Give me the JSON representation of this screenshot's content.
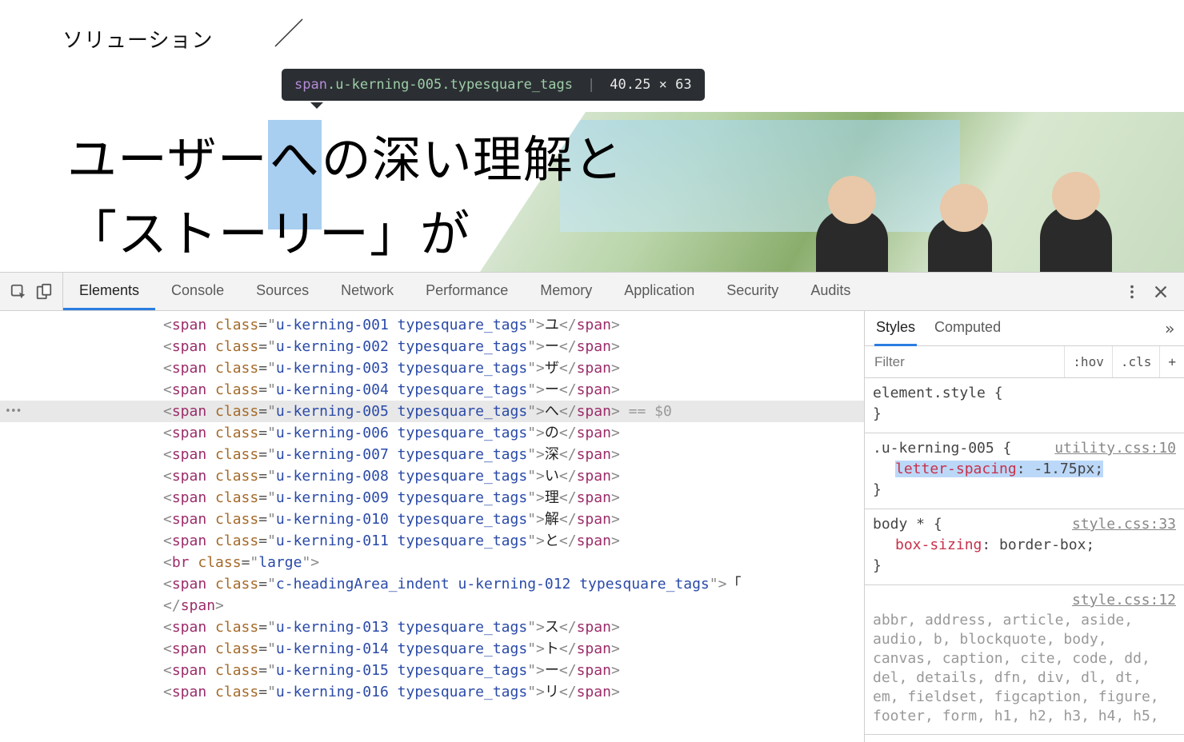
{
  "page": {
    "solution_label": "ソリューション",
    "headline_line1_before": "ユーザー",
    "headline_line1_highlight": "へ",
    "headline_line1_after": "の深い理解と",
    "headline_line2": "「ストーリー」が"
  },
  "tooltip": {
    "tag": "span",
    "classes": ".u-kerning-005.typesquare_tags",
    "separator": "|",
    "dimensions": "40.25 × 63"
  },
  "devtools": {
    "tabs": [
      "Elements",
      "Console",
      "Sources",
      "Network",
      "Performance",
      "Memory",
      "Application",
      "Security",
      "Audits"
    ],
    "active_tab": "Elements"
  },
  "elements": {
    "lines": [
      {
        "cls": "u-kerning-001 typesquare_tags",
        "txt": "ユ"
      },
      {
        "cls": "u-kerning-002 typesquare_tags",
        "txt": "ー"
      },
      {
        "cls": "u-kerning-003 typesquare_tags",
        "txt": "ザ"
      },
      {
        "cls": "u-kerning-004 typesquare_tags",
        "txt": "ー"
      },
      {
        "cls": "u-kerning-005 typesquare_tags",
        "txt": "へ",
        "selected": true,
        "suffix": "== $0"
      },
      {
        "cls": "u-kerning-006 typesquare_tags",
        "txt": "の"
      },
      {
        "cls": "u-kerning-007 typesquare_tags",
        "txt": "深"
      },
      {
        "cls": "u-kerning-008 typesquare_tags",
        "txt": "い"
      },
      {
        "cls": "u-kerning-009 typesquare_tags",
        "txt": "理"
      },
      {
        "cls": "u-kerning-010 typesquare_tags",
        "txt": "解"
      },
      {
        "cls": "u-kerning-011 typesquare_tags",
        "txt": "と"
      }
    ],
    "br_class": "large",
    "indent_span_class": "c-headingArea_indent u-kerning-012 typesquare_tags",
    "indent_span_text": "「",
    "lines2": [
      {
        "cls": "u-kerning-013 typesquare_tags",
        "txt": "ス"
      },
      {
        "cls": "u-kerning-014 typesquare_tags",
        "txt": "ト"
      },
      {
        "cls": "u-kerning-015 typesquare_tags",
        "txt": "ー"
      },
      {
        "cls": "u-kerning-016 typesquare_tags",
        "txt": "リ"
      }
    ]
  },
  "styles": {
    "subtabs": [
      "Styles",
      "Computed"
    ],
    "more_glyph": "»",
    "filter_placeholder": "Filter",
    "tool_hov": ":hov",
    "tool_cls": ".cls",
    "tool_plus": "+",
    "rules": [
      {
        "selector": "element.style {",
        "src": "",
        "props": [],
        "close": "}"
      },
      {
        "selector": ".u-kerning-005 {",
        "src": "utility.css:10",
        "props": [
          {
            "name": "letter-spacing",
            "value": "-1.75px;",
            "hl": true
          }
        ],
        "close": "}"
      },
      {
        "selector": "body * {",
        "src": "style.css:33",
        "props": [
          {
            "name": "box-sizing",
            "value": "border-box;"
          }
        ],
        "close": "}"
      }
    ],
    "reset_selector_src": "style.css:12",
    "reset_selectors": "abbr, address, article, aside, audio, b, blockquote, body, canvas, caption, cite, code, dd, del, details, dfn, div, dl, dt, em, fieldset, figcaption, figure, footer, form, h1, h2, h3, h4, h5,"
  }
}
